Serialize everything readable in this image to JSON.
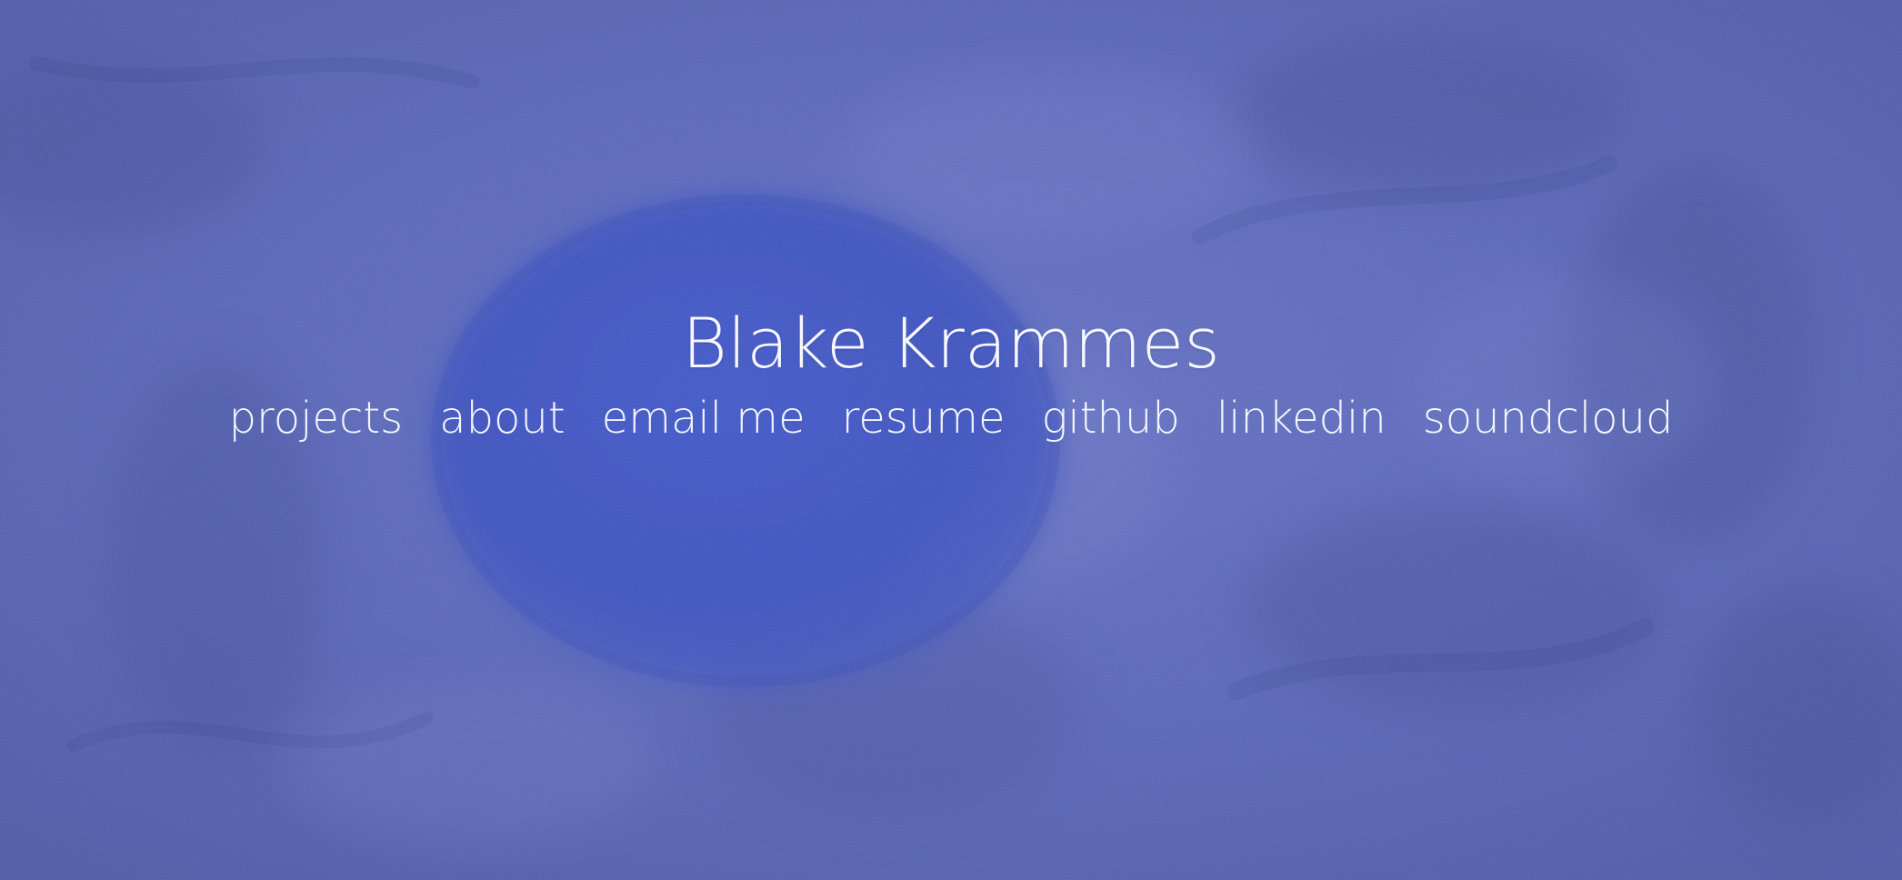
{
  "page": {
    "title": "Blake Krammes"
  },
  "nav": {
    "items": [
      {
        "label": "projects"
      },
      {
        "label": "about"
      },
      {
        "label": "email me"
      },
      {
        "label": "resume"
      },
      {
        "label": "github"
      },
      {
        "label": "linkedin"
      },
      {
        "label": "soundcloud"
      }
    ]
  },
  "colors": {
    "background": "#5966b8",
    "foreground": "#f3f5ff",
    "accent": "#3f56c8"
  }
}
